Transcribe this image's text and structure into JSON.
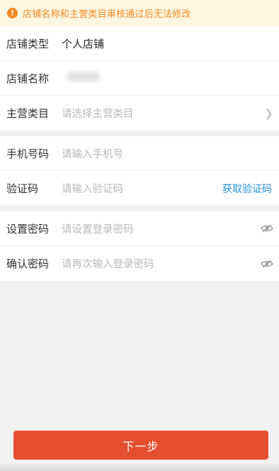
{
  "notice": {
    "icon": "warning-icon",
    "text": "店铺名称和主营类目审核通过后无法修改"
  },
  "shop": {
    "type_label": "店铺类型",
    "type_value": "个人店铺",
    "name_label": "店铺名称",
    "category_label": "主营类目",
    "category_placeholder": "请选择主营类目"
  },
  "phone": {
    "mobile_label": "手机号码",
    "mobile_placeholder": "请输入手机号",
    "code_label": "验证码",
    "code_placeholder": "请输入验证码",
    "get_code": "获取验证码"
  },
  "password": {
    "set_label": "设置密码",
    "set_placeholder": "请设置登录密码",
    "confirm_label": "确认密码",
    "confirm_placeholder": "请再次输入登录密码"
  },
  "footer": {
    "next_label": "下一步"
  },
  "colors": {
    "accent": "#e4502f",
    "warning": "#f08a24",
    "link": "#2592d8"
  }
}
